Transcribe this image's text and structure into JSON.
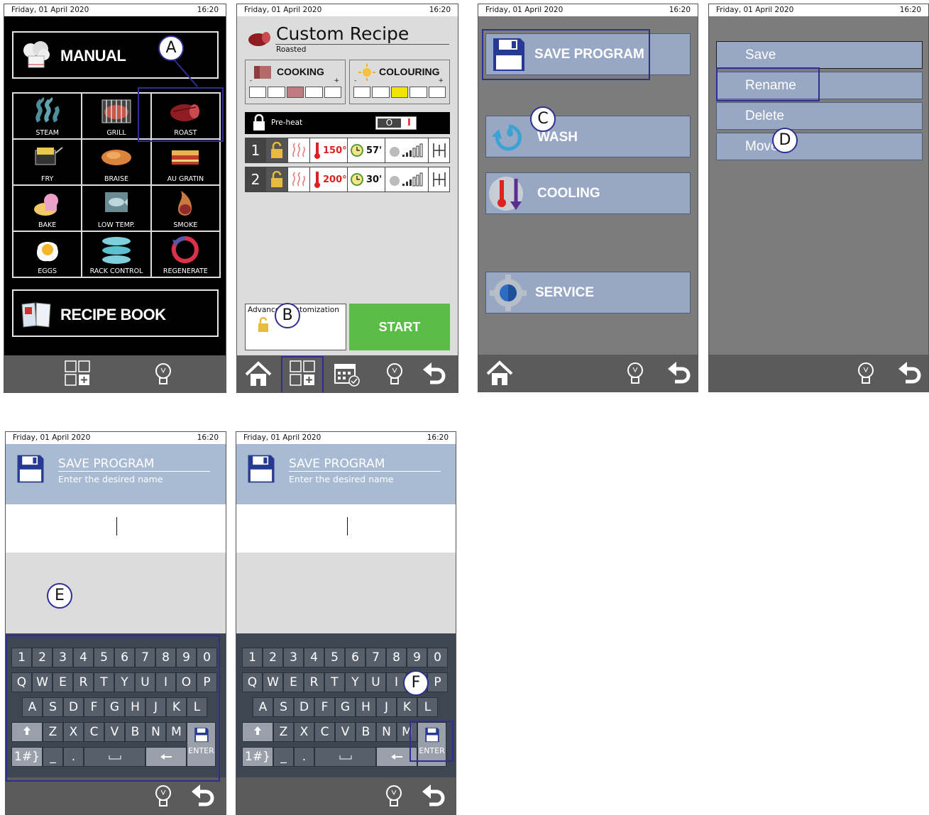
{
  "status": {
    "date": "Friday, 01 April 2020",
    "time": "16:20"
  },
  "screen1": {
    "manual_label": "MANUAL",
    "recipe_book_label": "RECIPE BOOK",
    "modes": [
      "STEAM",
      "GRILL",
      "ROAST",
      "FRY",
      "BRAISE",
      "AU GRATIN",
      "BAKE",
      "LOW TEMP.",
      "SMOKE",
      "EGGS",
      "RACK CONTROL",
      "REGENERATE"
    ]
  },
  "screen2": {
    "title": "Custom Recipe",
    "subtitle": "Roasted",
    "cooking_label": "COOKING",
    "colouring_label": "COLOURING",
    "minus": "-",
    "plus": "+",
    "preheat_label": "Pre-heat",
    "toggle_off": "O",
    "toggle_on": "I",
    "phases": [
      {
        "num": "1",
        "temp": "150°",
        "time": "57'"
      },
      {
        "num": "2",
        "temp": "200°",
        "time": "30'"
      }
    ],
    "advanced_label": "Advanced customization",
    "start_label": "START",
    "cooking_level": 3,
    "colouring_level": 3
  },
  "screen3": {
    "items": [
      "SAVE PROGRAM",
      "WASH",
      "COOLING",
      "SERVICE"
    ]
  },
  "screen4": {
    "items": [
      "Save",
      "Rename",
      "Delete",
      "Move"
    ]
  },
  "keyboard_screen": {
    "title": "SAVE PROGRAM",
    "subtitle": "Enter the desired name",
    "row1": [
      "1",
      "2",
      "3",
      "4",
      "5",
      "6",
      "7",
      "8",
      "9",
      "0"
    ],
    "row2": [
      "Q",
      "W",
      "E",
      "R",
      "T",
      "Y",
      "U",
      "I",
      "O",
      "P"
    ],
    "row3": [
      "A",
      "S",
      "D",
      "F",
      "G",
      "H",
      "J",
      "K",
      "L"
    ],
    "row4": [
      "Z",
      "X",
      "C",
      "V",
      "B",
      "N",
      "M"
    ],
    "symbols_key": "1#}",
    "underscore_key": "_",
    "dot_key": ".",
    "enter_label": "ENTER"
  },
  "callouts": [
    "A",
    "B",
    "C",
    "D",
    "E",
    "F"
  ],
  "colors": {
    "highlight": "#2e2f91",
    "start_green": "#5bbd47",
    "menu_blue": "#98a8c4",
    "keyboard_bg": "#3e4652"
  }
}
